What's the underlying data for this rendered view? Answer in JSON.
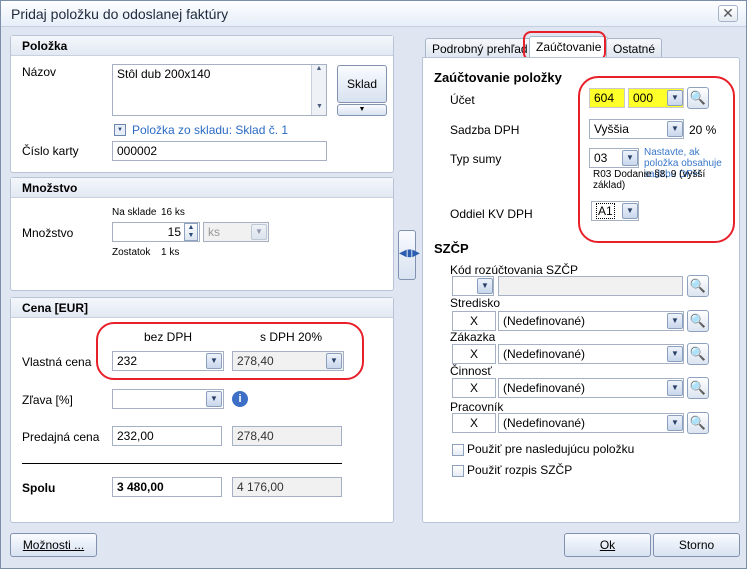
{
  "window": {
    "title": "Pridaj položku do odoslanej faktúry",
    "close": "✕"
  },
  "item": {
    "header": "Položka",
    "name_label": "Názov",
    "name_value": "Stôl dub 200x140",
    "warehouse_button": "Sklad",
    "warehouse_link": "Položka zo skladu: Sklad č. 1",
    "card_label": "Číslo karty",
    "card_value": "000002"
  },
  "quantity": {
    "header": "Množstvo",
    "stock_label": "Na sklade",
    "stock_value": "16 ks",
    "qty_label": "Množstvo",
    "qty_value": "15",
    "unit_value": "ks",
    "remaining_label": "Zostatok",
    "remaining_value": "1 ks"
  },
  "price": {
    "header": "Cena [EUR]",
    "col_without_vat": "bez DPH",
    "col_with_vat": "s DPH 20%",
    "own_price_label": "Vlastná cena",
    "own_price_net": "232",
    "own_price_gross": "278,40",
    "discount_label": "Zľava [%]",
    "discount_value": "",
    "sale_price_label": "Predajná cena",
    "sale_price_net": "232,00",
    "sale_price_gross": "278,40",
    "total_label": "Spolu",
    "total_net": "3 480,00",
    "total_gross": "4 176,00"
  },
  "tabs": [
    {
      "label": "Podrobný prehľad"
    },
    {
      "label": "Zaúčtovanie"
    },
    {
      "label": "Ostatné"
    }
  ],
  "posting": {
    "header": "Zaúčtovanie položky",
    "account_label": "Účet",
    "account_main": "604",
    "account_sub": "000",
    "vat_rate_label": "Sadzba DPH",
    "vat_rate_value": "Vyššia",
    "vat_rate_pct": "20 %",
    "sum_type_label": "Typ sumy",
    "sum_type_value": "03",
    "sum_type_note": "Nastavte, ak položka obsahuje sadzbu DPH",
    "sum_type_desc": "R03 Dodanie §8, 9 (vyšší základ)",
    "kv_label": "Oddiel KV DPH",
    "kv_value": "A1"
  },
  "szcp": {
    "header": "SZČP",
    "code_label": "Kód rozúčtovania SZČP",
    "code_value": "",
    "center_label": "Stredisko",
    "order_label": "Zákazka",
    "activity_label": "Činnosť",
    "worker_label": "Pracovník",
    "x_value": "X",
    "undefined_value": "(Nedefinované)",
    "use_next_label": "Použiť pre nasledujúcu položku",
    "use_breakdown_label": "Použiť rozpis SZČP"
  },
  "footer": {
    "options": "Možnosti ...",
    "ok": "Ok",
    "cancel": "Storno"
  }
}
